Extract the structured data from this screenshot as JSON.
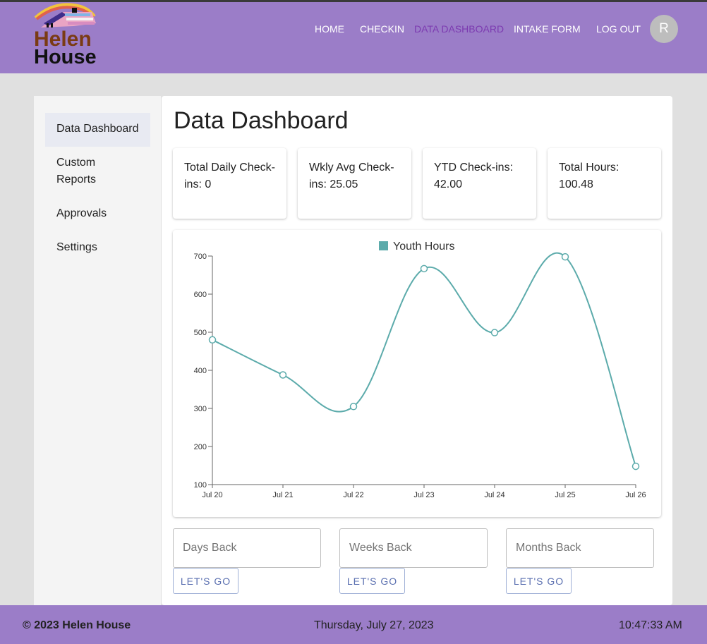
{
  "brand": {
    "line1": "Helen",
    "line2": "House"
  },
  "nav": {
    "items": [
      {
        "label": "HOME",
        "active": false
      },
      {
        "label": "CHECKIN",
        "active": false
      },
      {
        "label": "DATA DASHBOARD",
        "active": true
      },
      {
        "label": "INTAKE FORM",
        "active": false
      },
      {
        "label": "LOG OUT",
        "active": false
      }
    ],
    "avatar_initial": "R"
  },
  "sidebar": {
    "items": [
      {
        "label": "Data Dashboard",
        "active": true
      },
      {
        "label": "Custom Reports",
        "active": false
      },
      {
        "label": "Approvals",
        "active": false
      },
      {
        "label": "Settings",
        "active": false
      }
    ]
  },
  "main": {
    "title": "Data Dashboard",
    "stats": [
      {
        "label": "Total Daily Check-ins: 0"
      },
      {
        "label": "Wkly Avg Check-ins: 25.05"
      },
      {
        "label": "YTD Check-ins: 42.00"
      },
      {
        "label": "Total Hours: 100.48"
      }
    ]
  },
  "chart_data": {
    "type": "line",
    "categories": [
      "Jul 20",
      "Jul 21",
      "Jul 22",
      "Jul 23",
      "Jul 24",
      "Jul 25",
      "Jul 26"
    ],
    "series": [
      {
        "name": "Youth Hours",
        "values": [
          480,
          388,
          305,
          667,
          499,
          698,
          148
        ],
        "color": "#5cabab"
      }
    ],
    "ylim": [
      100,
      700
    ],
    "yticks": [
      100,
      200,
      300,
      400,
      500,
      600,
      700
    ],
    "legend": "top-center",
    "grid": false
  },
  "filters": [
    {
      "placeholder": "Days Back",
      "button": "LET'S GO"
    },
    {
      "placeholder": "Weeks Back",
      "button": "LET'S GO"
    },
    {
      "placeholder": "Months Back",
      "button": "LET'S GO"
    }
  ],
  "footer": {
    "copyright": "© 2023 Helen House",
    "date": "Thursday, July 27, 2023",
    "time": "10:47:33 AM"
  },
  "colors": {
    "header": "#9b7dc8",
    "active_nav": "#7c3ab0",
    "series": "#5cabab"
  }
}
